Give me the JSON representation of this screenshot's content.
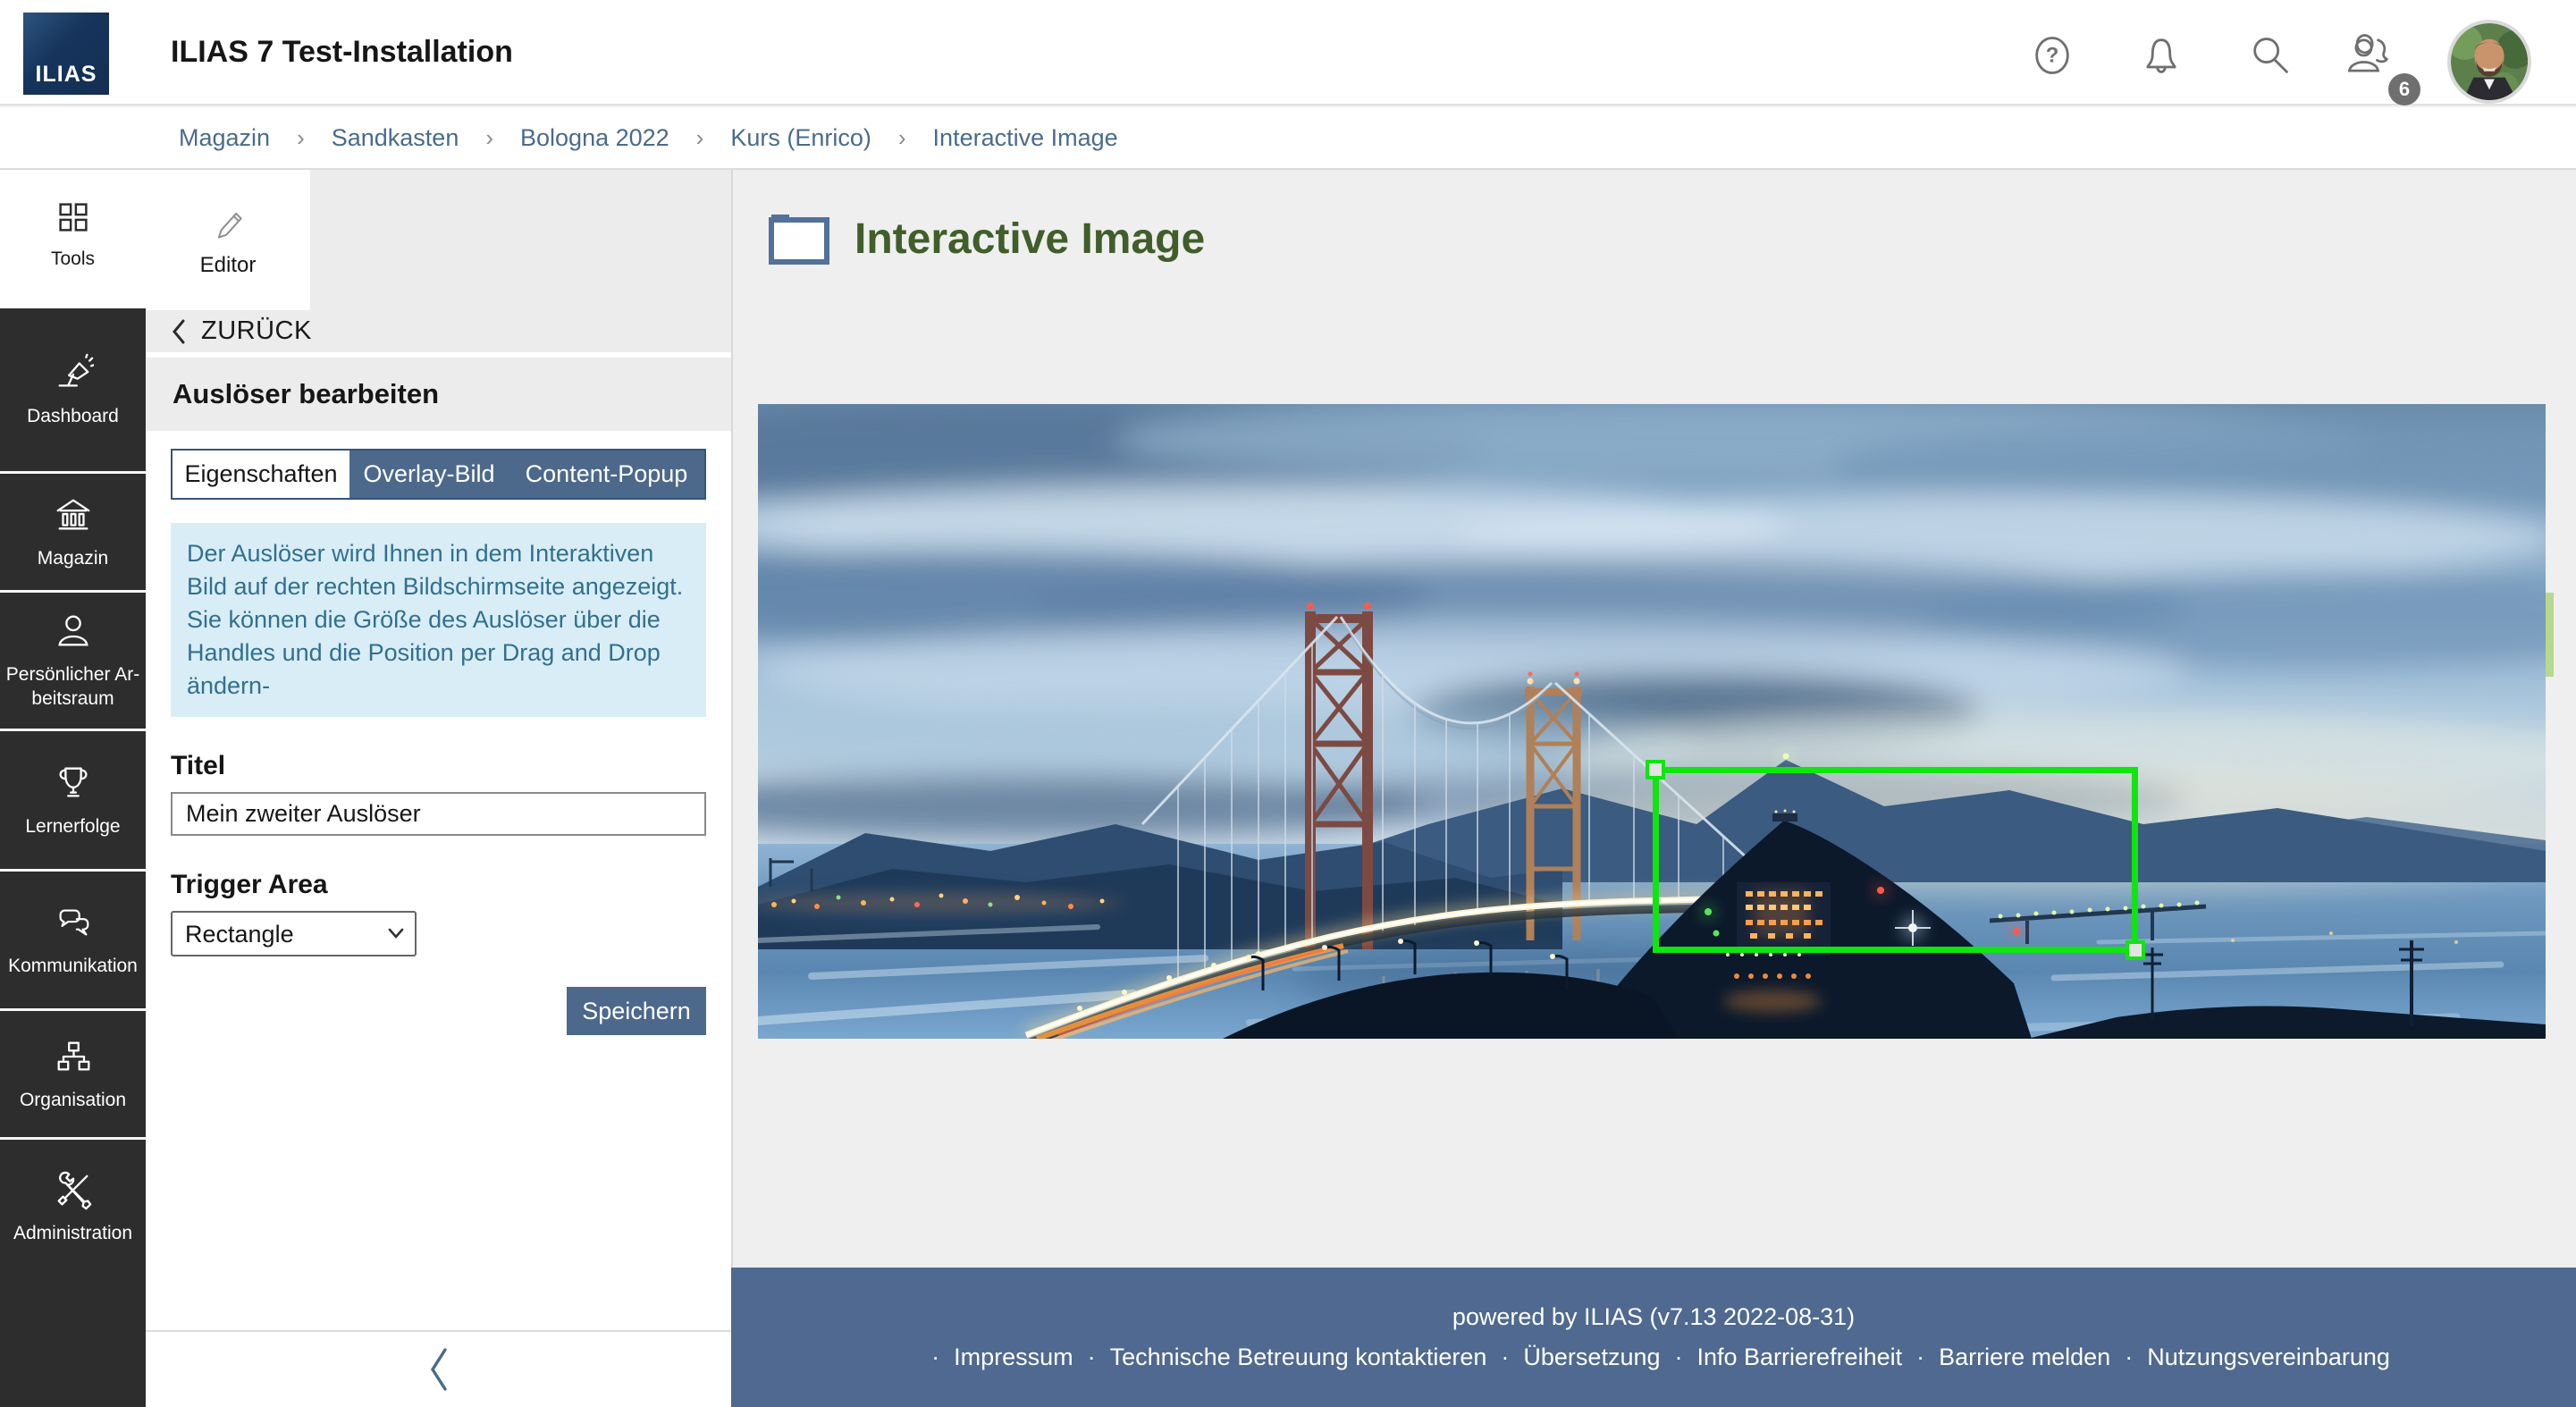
{
  "colors": {
    "accent": "#4c698c",
    "accent-dark": "#355579",
    "footer-bg": "#4f6990",
    "trigger-green": "#10e510",
    "edge-green": "#b7d98f",
    "info-bg": "#d9edf7",
    "info-text": "#31708f",
    "title-green": "#405e2a",
    "folder-blue": "#51719b",
    "sidebar-dark": "#2d2d2d",
    "link-blue": "#4a6b8c"
  },
  "header": {
    "logo_text": "ILIAS",
    "title": "ILIAS 7 Test-Installation",
    "help_icon": "question-mark-circle",
    "notifications_icon": "bell",
    "search_icon": "magnifier",
    "online_icon": "two-users",
    "online_badge": "6"
  },
  "breadcrumb": {
    "separator": "›",
    "items": [
      "Magazin",
      "Sandkasten",
      "Bologna 2022",
      "Kurs (Enrico)",
      "Interactive Image"
    ]
  },
  "sidebar": {
    "tools_label": "Tools",
    "items": [
      {
        "id": "dashboard",
        "label": "Dashboard",
        "icon": "desk-lamp"
      },
      {
        "id": "magazin",
        "label": "Magazin",
        "icon": "bank"
      },
      {
        "id": "workspace",
        "label": "Persönlicher Ar-\nbeitsraum",
        "icon": "person"
      },
      {
        "id": "achievements",
        "label": "Lernerfolge",
        "icon": "trophy"
      },
      {
        "id": "communication",
        "label": "Kommunikation",
        "icon": "speech-bubbles"
      },
      {
        "id": "organisation",
        "label": "Organisation",
        "icon": "org-chart"
      },
      {
        "id": "administration",
        "label": "Administration",
        "icon": "crossed-tools"
      }
    ]
  },
  "editor_panel": {
    "tool_label": "Editor",
    "back_label": "ZURÜCK",
    "heading": "Auslöser bearbeiten",
    "tabs": [
      {
        "label": "Eigenschaften",
        "active": true
      },
      {
        "label": "Overlay-Bild",
        "active": false
      },
      {
        "label": "Content-Popup",
        "active": false
      }
    ],
    "info_lines": [
      "Der Auslöser wird Ihnen in dem Interaktiven Bild auf der rechten Bildschirmseite angezeigt.",
      "Sie können die Größe des Auslöser über die Handles und die Position per Drag and Drop ändern-"
    ],
    "title_label": "Titel",
    "title_value": "Mein zweiter Auslöser",
    "trigger_area_label": "Trigger Area",
    "trigger_area_value": "Rectangle",
    "save_label": "Speichern"
  },
  "main": {
    "page_title": "Interactive Image"
  },
  "footer": {
    "powered_by": "powered by ILIAS (v7.13 2022-08-31)",
    "separator": "·",
    "links": [
      "Impressum",
      "Technische Betreuung kontaktieren",
      "Übersetzung",
      "Info Barrierefreiheit",
      "Barriere melden",
      "Nutzungsvereinbarung"
    ]
  }
}
